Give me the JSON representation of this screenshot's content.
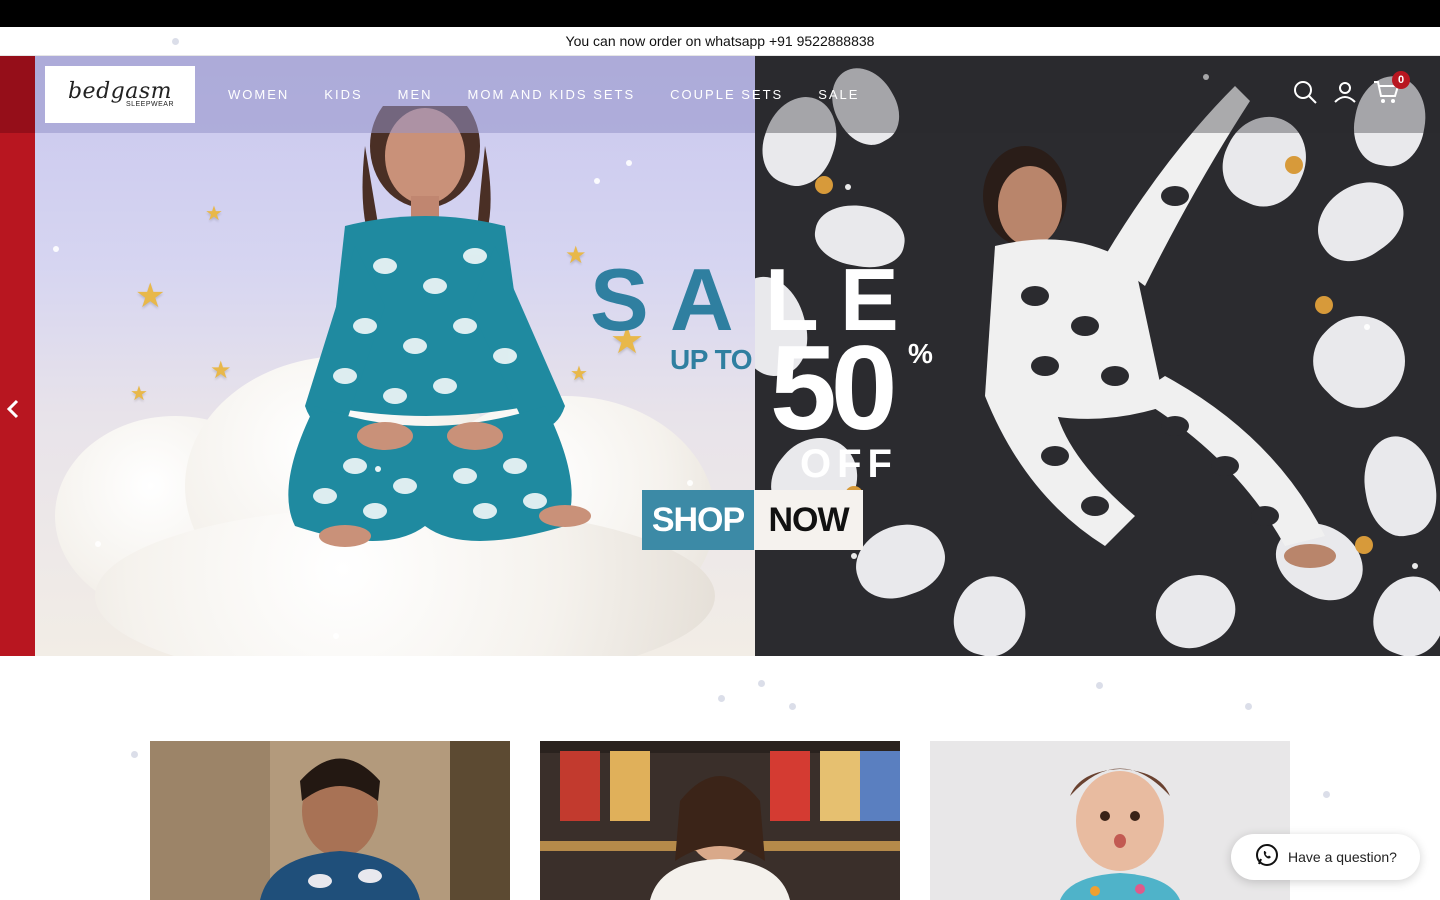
{
  "announcement": {
    "text": "You can now order on whatsapp +91 9522888838"
  },
  "header": {
    "logo_text": "bedgasm",
    "logo_sub": "SLEEPWEAR",
    "nav": [
      "WOMEN",
      "KIDS",
      "MEN",
      "MOM AND KIDS SETS",
      "COUPLE SETS",
      "SALE"
    ],
    "icons": [
      "search-icon",
      "account-icon",
      "cart-icon"
    ],
    "cart_count": "0"
  },
  "hero": {
    "sale_letters": [
      "S",
      "A",
      "L",
      "E"
    ],
    "up_to": "UP TO",
    "discount": "50",
    "percent": "%",
    "off": "OFF",
    "shop_a": "SHOP",
    "shop_b": "NOW",
    "prev_icon": "chevron-left-icon"
  },
  "colors": {
    "accent_red": "#b81620",
    "teal": "#3c8aa6"
  },
  "help": {
    "label": "Have a question?",
    "icon": "whatsapp-icon"
  }
}
